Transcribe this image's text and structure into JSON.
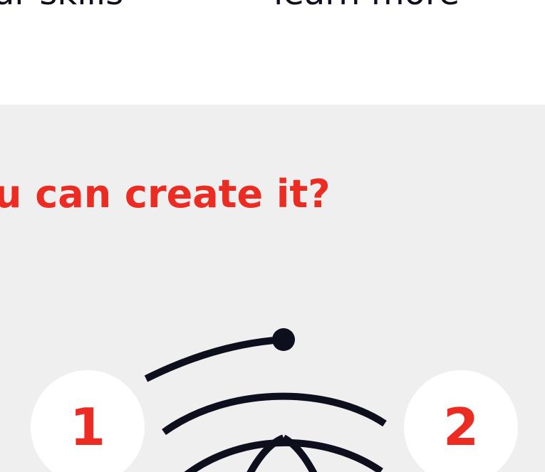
{
  "top": {
    "left_fragment": "ur skills",
    "right_fragment": "learn more"
  },
  "section": {
    "headline": "u can create it?"
  },
  "steps": [
    {
      "number": "1"
    },
    {
      "number": "2"
    }
  ],
  "colors": {
    "accent": "#ec2b22",
    "dark": "#0e0f1c",
    "section_bg": "#efefef",
    "circle_bg": "#ffffff"
  },
  "icons": {
    "illustration": "connection-arcs-illustration-icon"
  }
}
